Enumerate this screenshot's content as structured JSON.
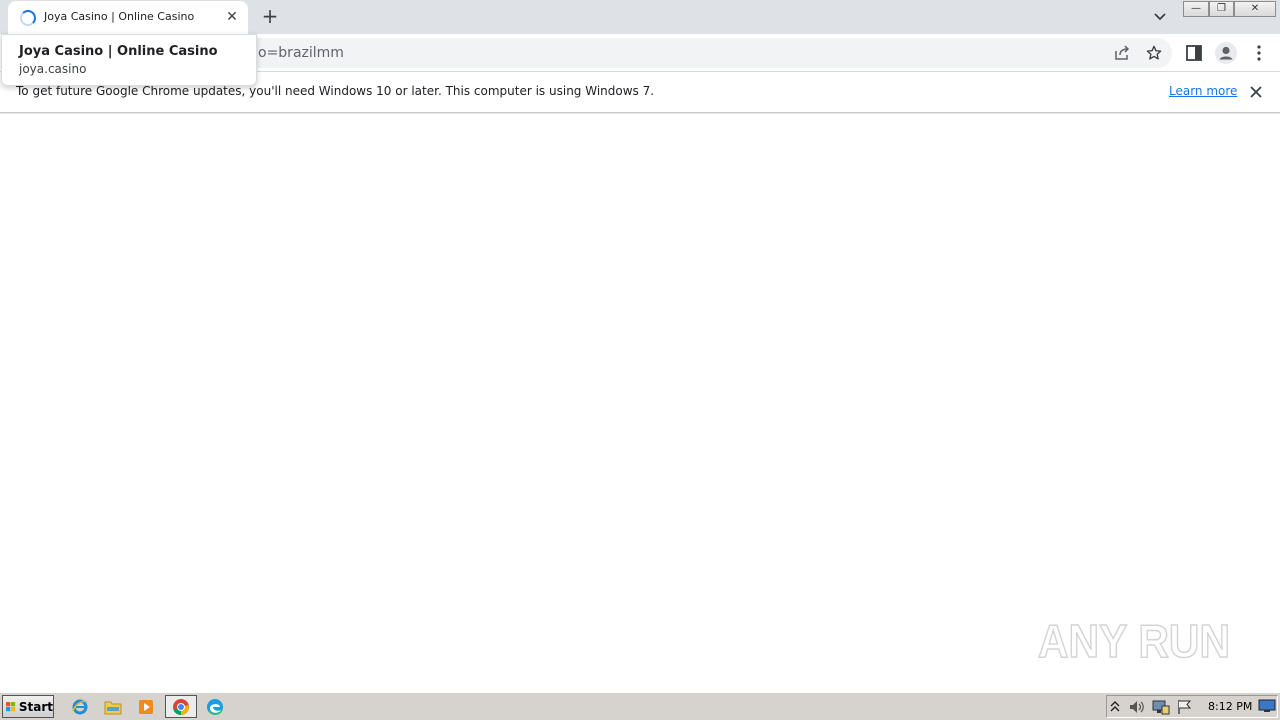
{
  "tab": {
    "title": "Joya Casino | Online Casino",
    "close": "✕"
  },
  "newtab": {
    "label": "+"
  },
  "window": {
    "minimize": "—",
    "restore": "❐",
    "close": "✕"
  },
  "omnibox": {
    "visible_text": "o=brazilmm"
  },
  "hovercard": {
    "title": "Joya Casino | Online Casino",
    "domain": "joya.casino"
  },
  "infobar": {
    "message": "To get future Google Chrome updates, you'll need Windows 10 or later. This computer is using Windows 7.",
    "link": "Learn more"
  },
  "watermark": {
    "text": "ANY RUN"
  },
  "taskbar": {
    "start": "Start",
    "clock": "8:12 PM"
  },
  "colors": {
    "accent": "#1a73e8",
    "tabstrip": "#dee1e6",
    "taskbar": "#d6d3ce"
  },
  "icons": [
    "loading-spinner-icon",
    "tab-close-icon",
    "new-tab-icon",
    "tab-search-icon",
    "share-icon",
    "bookmark-star-icon",
    "side-panel-icon",
    "profile-icon",
    "menu-dots-icon",
    "close-icon",
    "windows-flag-icon",
    "ie-icon",
    "explorer-icon",
    "media-player-icon",
    "chrome-icon",
    "edge-icon",
    "tray-arrow-icon",
    "volume-icon",
    "network-icon",
    "action-center-flag-icon",
    "show-desktop-icon"
  ]
}
